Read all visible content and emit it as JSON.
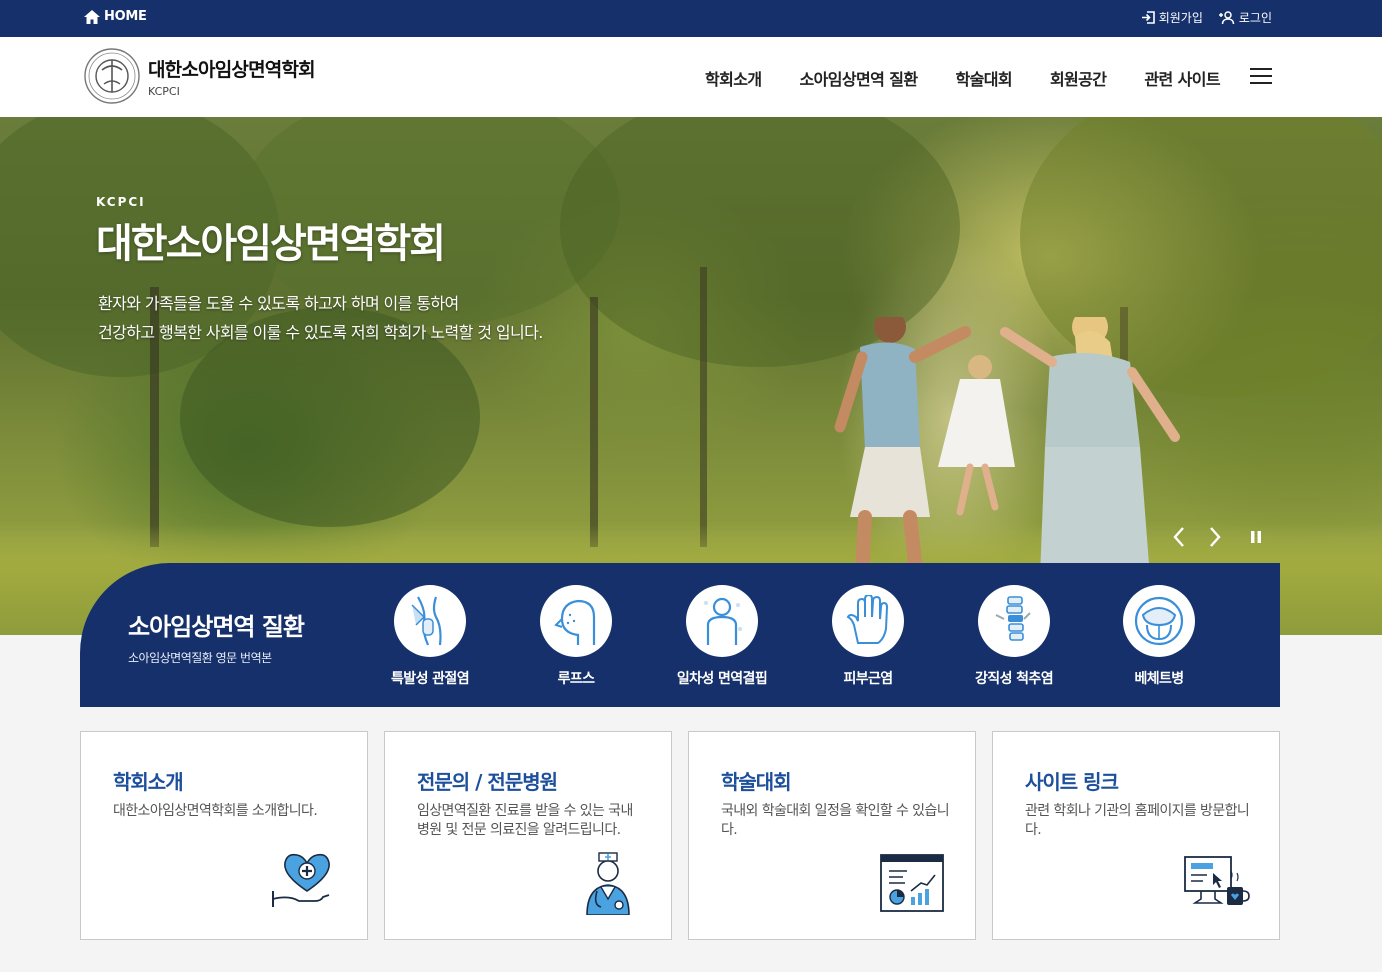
{
  "topbar": {
    "home": "HOME",
    "signup": "회원가입",
    "login": "로그인"
  },
  "header": {
    "site_name": "대한소아임상면역학회",
    "site_abbr": "KCPCI",
    "nav": [
      "학회소개",
      "소아임상면역 질환",
      "학술대회",
      "회원공간",
      "관련 사이트"
    ]
  },
  "hero": {
    "kicker": "KCPCI",
    "title": "대한소아임상면역학회",
    "line1": "환자와 가족들을 도울 수 있도록 하고자 하며 이를 통하여",
    "line2": "건강하고 행복한 사회를 이룰 수 있도록 저희 학회가 노력할 것 입니다.",
    "controls": {
      "prev_icon": "chevron-left-icon",
      "next_icon": "chevron-right-icon",
      "pause_icon": "pause-icon"
    }
  },
  "diseases": {
    "title": "소아임상면역 질환",
    "subtitle": "소아임상면역질환 영문 번역본",
    "items": [
      {
        "label": "특발성 관절염",
        "icon": "joint-icon"
      },
      {
        "label": "루프스",
        "icon": "face-icon"
      },
      {
        "label": "일차성 면역결핍",
        "icon": "body-icon"
      },
      {
        "label": "피부근염",
        "icon": "hand-icon"
      },
      {
        "label": "강직성 척추염",
        "icon": "spine-icon"
      },
      {
        "label": "베체트병",
        "icon": "mouth-icon"
      }
    ]
  },
  "cards": [
    {
      "title": "학회소개",
      "desc": "대한소아임상면역학회를 소개합니다.",
      "icon": "heart-hand-icon"
    },
    {
      "title": "전문의 / 전문병원",
      "desc": "임상면역질환 진료를 받을 수 있는 국내 병원 및 전문 의료진을 알려드립니다.",
      "icon": "doctor-icon"
    },
    {
      "title": "학술대회",
      "desc": "국내외 학술대회 일정을 확인할 수 있습니다.",
      "icon": "chart-screen-icon"
    },
    {
      "title": "사이트 링크",
      "desc": "관련 학회나 기관의 홈페이지를 방문합니다.",
      "icon": "computer-link-icon"
    }
  ],
  "colors": {
    "navy": "#15306a",
    "card_title": "#1d4f9c",
    "icon_blue": "#3a8fd8"
  }
}
